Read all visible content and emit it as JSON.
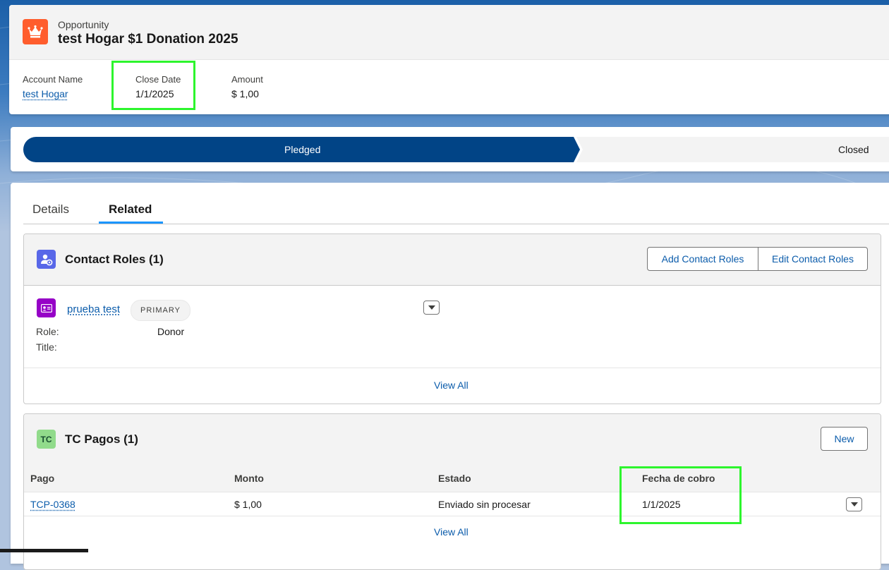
{
  "record": {
    "object_type": "Opportunity",
    "title": "test Hogar $1 Donation 2025",
    "fields": [
      {
        "label": "Account Name",
        "value": "test Hogar"
      },
      {
        "label": "Close Date",
        "value": "1/1/2025"
      },
      {
        "label": "Amount",
        "value": "$ 1,00"
      }
    ]
  },
  "path": {
    "stages": [
      {
        "label": "Pledged",
        "state": "current"
      },
      {
        "label": "Closed",
        "state": "incomplete"
      }
    ]
  },
  "tabs": [
    {
      "label": "Details",
      "active": false
    },
    {
      "label": "Related",
      "active": true
    }
  ],
  "contact_roles": {
    "title": "Contact Roles (1)",
    "buttons": [
      "Add Contact Roles",
      "Edit Contact Roles"
    ],
    "item": {
      "name": "prueba test",
      "badge": "PRIMARY",
      "fields": [
        {
          "label": "Role:",
          "value": "Donor"
        },
        {
          "label": "Title:",
          "value": ""
        }
      ]
    },
    "view_all": "View All"
  },
  "tc_pagos": {
    "icon_text": "TC",
    "title": "TC Pagos (1)",
    "new_button": "New",
    "columns": [
      "Pago",
      "Monto",
      "Estado",
      "Fecha de cobro"
    ],
    "rows": [
      {
        "pago": "TCP-0368",
        "monto": "$ 1,00",
        "estado": "Enviado sin procesar",
        "fecha": "1/1/2025"
      }
    ],
    "view_all": "View All"
  },
  "colors": {
    "brand_blue": "#014486",
    "link": "#0b5cab",
    "opportunity_icon": "#ff5d2d",
    "highlight": "#2df52d"
  }
}
